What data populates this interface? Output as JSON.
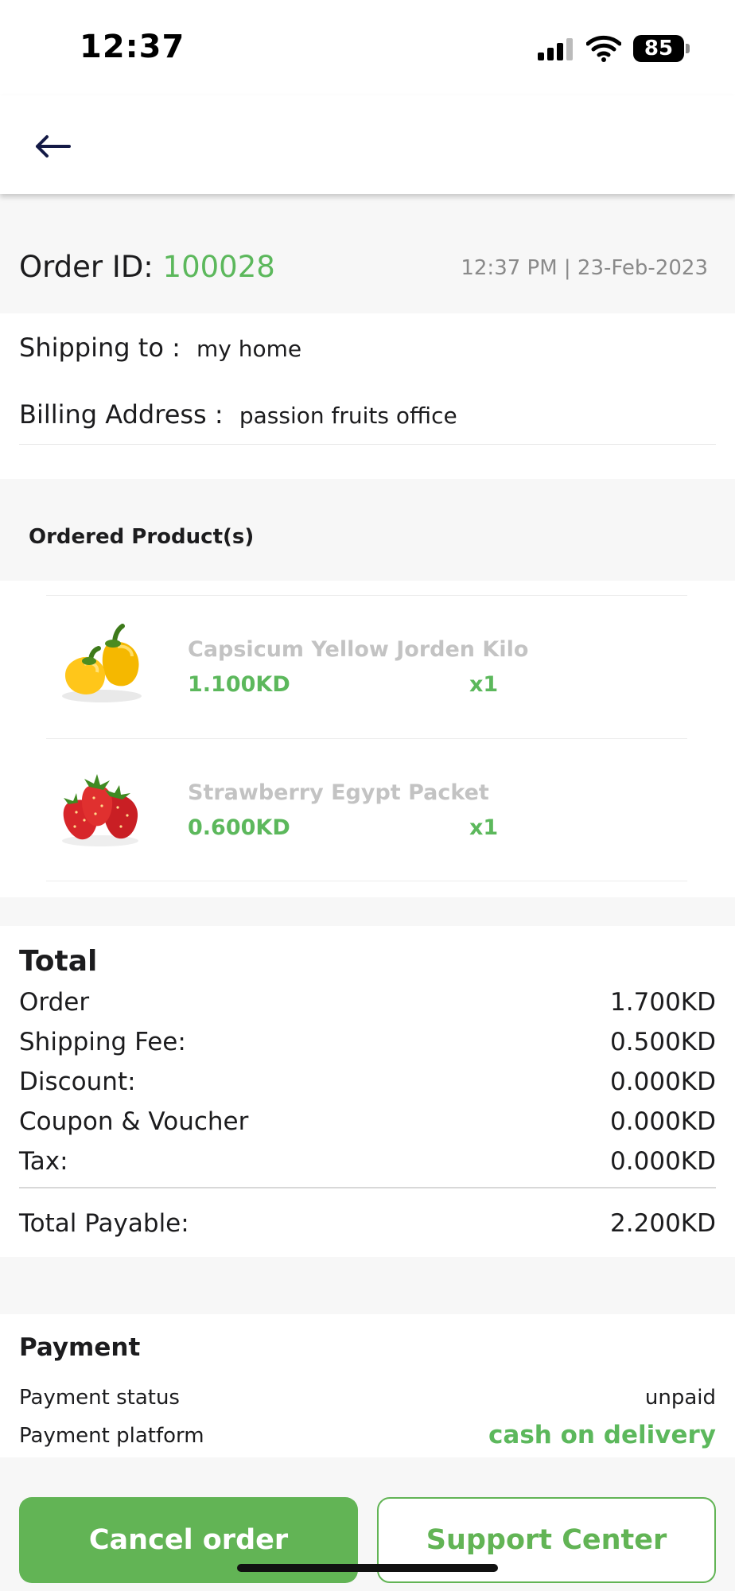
{
  "status_bar": {
    "time": "12:37",
    "battery": "85"
  },
  "order": {
    "id_label": "Order ID: ",
    "id": "100028",
    "datetime": "12:37 PM | 23-Feb-2023"
  },
  "address": {
    "shipping_label": "Shipping to : ",
    "shipping_value": "my home",
    "billing_label": "Billing Address : ",
    "billing_value": "passion fruits office"
  },
  "products_section": {
    "title": "Ordered Product(s)",
    "items": [
      {
        "name": "Capsicum Yellow Jorden Kilo",
        "price": "1.100KD",
        "qty": "x1",
        "icon": "yellow-capsicum-image"
      },
      {
        "name": "Strawberry Egypt Packet",
        "price": "0.600KD",
        "qty": "x1",
        "icon": "strawberry-image"
      }
    ]
  },
  "totals": {
    "title": "Total",
    "rows": [
      {
        "label": "Order",
        "value": "1.700KD"
      },
      {
        "label": "Shipping Fee:",
        "value": "0.500KD"
      },
      {
        "label": "Discount:",
        "value": "0.000KD"
      },
      {
        "label": "Coupon & Voucher",
        "value": "0.000KD"
      },
      {
        "label": "Tax:",
        "value": "0.000KD"
      }
    ],
    "payable_label": "Total Payable:",
    "payable_value": "2.200KD"
  },
  "payment": {
    "title": "Payment",
    "status_label": "Payment status",
    "status_value": "unpaid",
    "platform_label": "Payment platform",
    "platform_value": "cash on delivery"
  },
  "actions": {
    "cancel_label": "Cancel order",
    "support_label": "Support Center"
  },
  "colors": {
    "accent": "#5cb85c",
    "button_green": "#62b455",
    "muted_text": "#c3c3c3"
  }
}
